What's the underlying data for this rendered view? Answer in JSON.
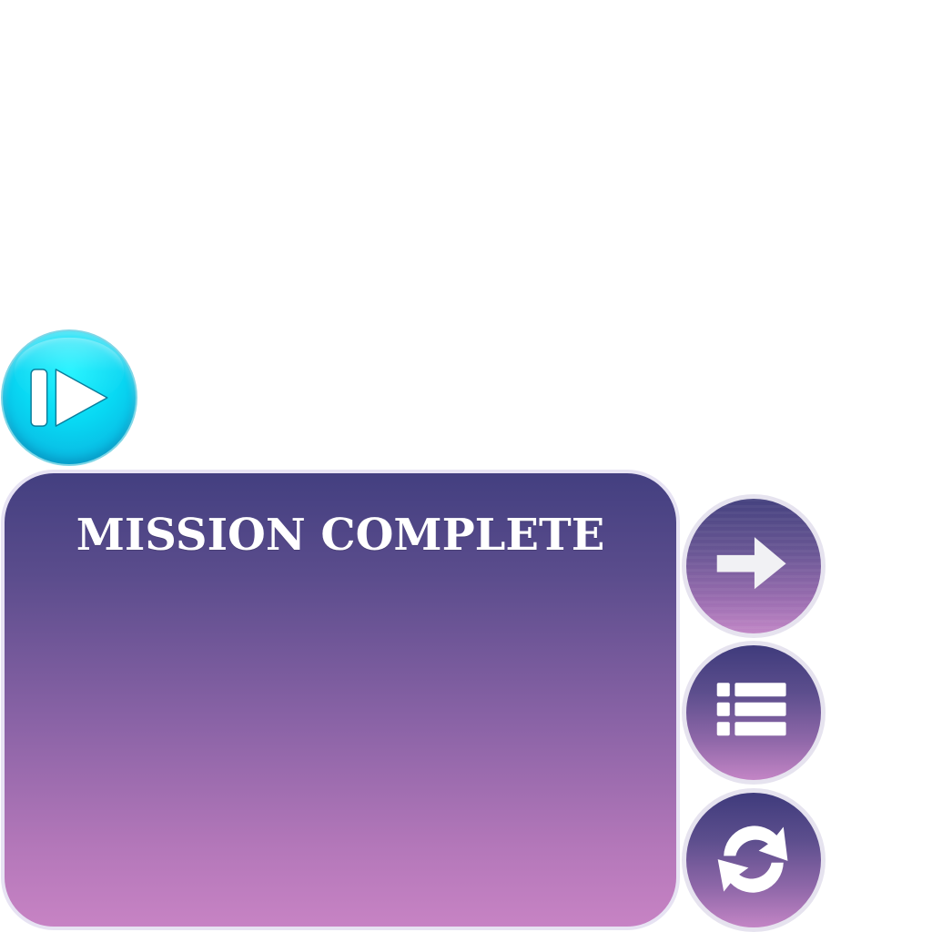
{
  "mission_panel": {
    "title": "MISSION COMPLETE"
  },
  "buttons": {
    "resume": {
      "icon": "play-resume-icon"
    },
    "next": {
      "icon": "arrow-right-icon"
    },
    "menu": {
      "icon": "list-menu-icon"
    },
    "retry": {
      "icon": "refresh-icon"
    }
  },
  "colors": {
    "panel_top": "#433f80",
    "panel_bottom": "#c783c4",
    "resume_button": "#08d8f3",
    "border": "#e7e3f3",
    "text": "#ffffff"
  }
}
